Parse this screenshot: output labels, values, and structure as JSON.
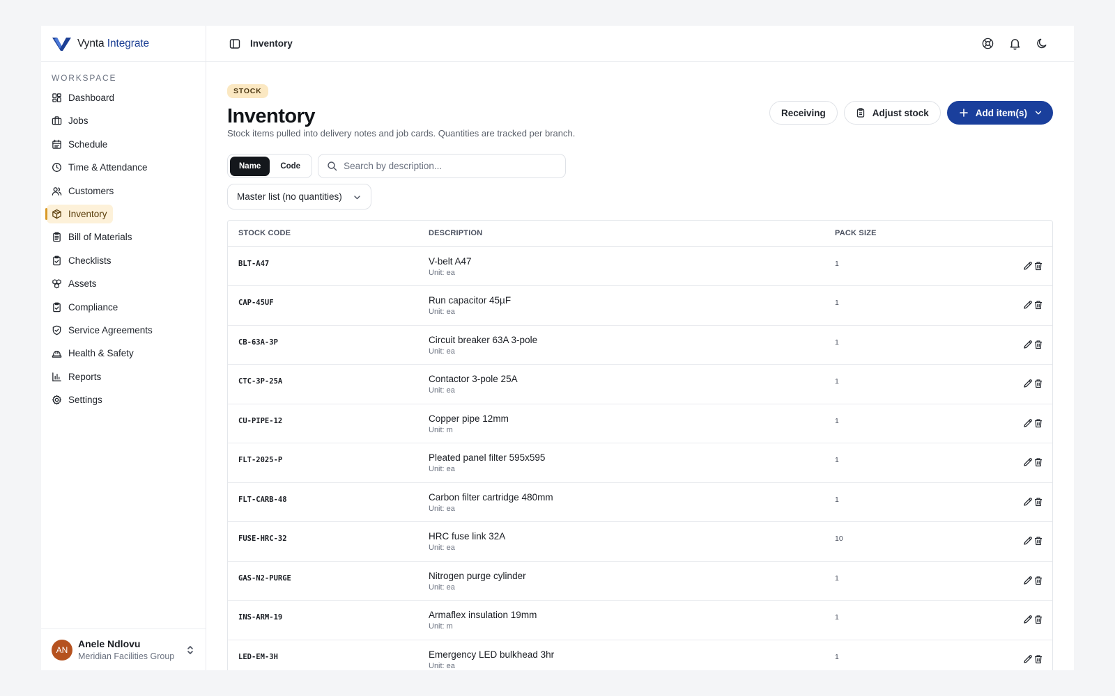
{
  "brand": {
    "name_a": "Vynta",
    "name_b": "Integrate"
  },
  "sidebar": {
    "section": "WORKSPACE",
    "items": [
      {
        "label": "Dashboard",
        "icon": "dashboard-icon"
      },
      {
        "label": "Jobs",
        "icon": "briefcase-icon"
      },
      {
        "label": "Schedule",
        "icon": "calendar-icon"
      },
      {
        "label": "Time & Attendance",
        "icon": "clock-icon"
      },
      {
        "label": "Customers",
        "icon": "users-icon"
      },
      {
        "label": "Inventory",
        "icon": "package-icon",
        "active": true
      },
      {
        "label": "Bill of Materials",
        "icon": "clipboard-list-icon"
      },
      {
        "label": "Checklists",
        "icon": "clipboard-check-icon"
      },
      {
        "label": "Assets",
        "icon": "boxes-icon"
      },
      {
        "label": "Compliance",
        "icon": "clipboard-check-icon"
      },
      {
        "label": "Service Agreements",
        "icon": "shield-check-icon"
      },
      {
        "label": "Health & Safety",
        "icon": "hard-hat-icon"
      },
      {
        "label": "Reports",
        "icon": "bar-chart-icon"
      },
      {
        "label": "Settings",
        "icon": "gear-icon"
      }
    ]
  },
  "user": {
    "initials": "AN",
    "name": "Anele Ndlovu",
    "org": "Meridian Facilities Group"
  },
  "topbar": {
    "breadcrumb": "Inventory"
  },
  "page": {
    "badge": "STOCK",
    "title": "Inventory",
    "subtitle": "Stock items pulled into delivery notes and job cards. Quantities are tracked per branch."
  },
  "actions": {
    "receiving": "Receiving",
    "adjust": "Adjust stock",
    "add": "Add item(s)"
  },
  "filters": {
    "mode_name": "Name",
    "mode_code": "Code",
    "search_placeholder": "Search by description...",
    "list_select": "Master list (no quantities)"
  },
  "table": {
    "headers": {
      "code": "STOCK CODE",
      "description": "DESCRIPTION",
      "pack": "PACK SIZE"
    },
    "rows": [
      {
        "code": "BLT-A47",
        "description": "V-belt A47",
        "unit": "Unit: ea",
        "pack": "1"
      },
      {
        "code": "CAP-45UF",
        "description": "Run capacitor 45µF",
        "unit": "Unit: ea",
        "pack": "1"
      },
      {
        "code": "CB-63A-3P",
        "description": "Circuit breaker 63A 3-pole",
        "unit": "Unit: ea",
        "pack": "1"
      },
      {
        "code": "CTC-3P-25A",
        "description": "Contactor 3-pole 25A",
        "unit": "Unit: ea",
        "pack": "1"
      },
      {
        "code": "CU-PIPE-12",
        "description": "Copper pipe 12mm",
        "unit": "Unit: m",
        "pack": "1"
      },
      {
        "code": "FLT-2025-P",
        "description": "Pleated panel filter 595x595",
        "unit": "Unit: ea",
        "pack": "1"
      },
      {
        "code": "FLT-CARB-48",
        "description": "Carbon filter cartridge 480mm",
        "unit": "Unit: ea",
        "pack": "1"
      },
      {
        "code": "FUSE-HRC-32",
        "description": "HRC fuse link 32A",
        "unit": "Unit: ea",
        "pack": "10"
      },
      {
        "code": "GAS-N2-PURGE",
        "description": "Nitrogen purge cylinder",
        "unit": "Unit: ea",
        "pack": "1"
      },
      {
        "code": "INS-ARM-19",
        "description": "Armaflex insulation 19mm",
        "unit": "Unit: m",
        "pack": "1"
      },
      {
        "code": "LED-EM-3H",
        "description": "Emergency LED bulkhead 3hr",
        "unit": "Unit: ea",
        "pack": "1"
      }
    ]
  },
  "colors": {
    "accent": "#1a3f9c",
    "active_bg": "#fdf1d9",
    "active_bar": "#d99a28",
    "avatar": "#b5521f"
  }
}
